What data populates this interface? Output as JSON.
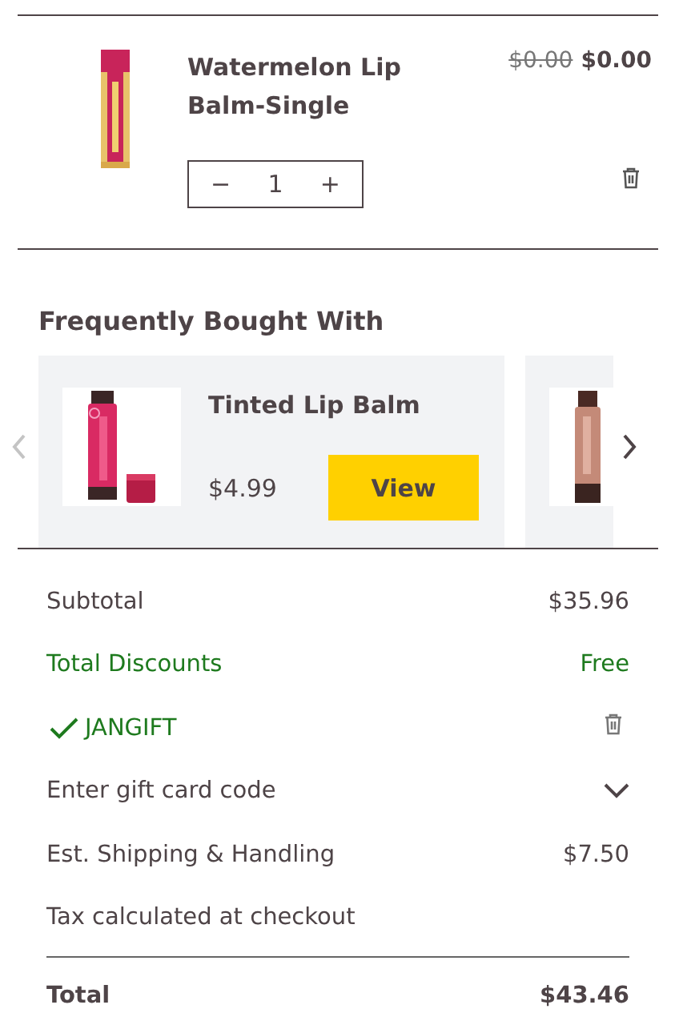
{
  "cart_item": {
    "name": "Watermelon Lip Balm-Single",
    "original_price": "$0.00",
    "price": "$0.00",
    "quantity": "1",
    "decrement": "−",
    "increment": "+"
  },
  "recommendations": {
    "title": "Frequently Bought With",
    "prev_disabled": true,
    "next_disabled": false,
    "items": [
      {
        "kind": "full",
        "name": "Tinted Lip Balm",
        "price": "$4.99",
        "button": "View"
      },
      {
        "kind": "clipped"
      }
    ]
  },
  "summary": [
    {
      "kind": "plain",
      "label": "Subtotal",
      "value": "$35.96"
    },
    {
      "kind": "discount",
      "label": "Total Discounts",
      "value": "Free"
    },
    {
      "kind": "coupon",
      "label": "JANGIFT"
    },
    {
      "kind": "expandable",
      "label": "Enter gift card code",
      "expanded": false
    },
    {
      "kind": "plain",
      "label": "Est. Shipping & Handling",
      "value": "$7.50"
    },
    {
      "kind": "plain",
      "label": "Tax calculated at checkout"
    }
  ],
  "total": {
    "label": "Total",
    "value": "$43.46"
  }
}
